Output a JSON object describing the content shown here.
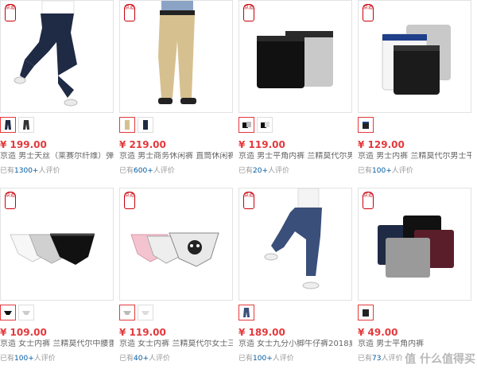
{
  "products": [
    {
      "seal": "京造",
      "price": "¥ 199.00",
      "title": "京造 男士天丝（莱赛尔纤维）弹力",
      "review_prefix": "已有",
      "review_count": "1300+",
      "review_suffix": "人评价",
      "thumbs": [
        "✕",
        "✕"
      ]
    },
    {
      "seal": "京造",
      "price": "¥ 219.00",
      "title": "京造 男士商务休闲裤 直筒休闲裤男",
      "review_prefix": "已有",
      "review_count": "600+",
      "review_suffix": "人评价",
      "thumbs": [
        "✕",
        "✕"
      ]
    },
    {
      "seal": "京造",
      "price": "¥ 119.00",
      "title": "京造 男士平角内裤 兰精莫代尔男士",
      "review_prefix": "已有",
      "review_count": "20+",
      "review_suffix": "人评价",
      "thumbs": [
        "✕",
        "✕"
      ]
    },
    {
      "seal": "京造",
      "price": "¥ 129.00",
      "title": "京造 男士内裤 兰精莫代尔男士平",
      "review_prefix": "已有",
      "review_count": "100+",
      "review_suffix": "人评价",
      "thumbs": [
        "✕"
      ]
    },
    {
      "seal": "京造",
      "price": "¥ 109.00",
      "title": "京造 女士内裤 兰精莫代尔中腰蕾丝",
      "review_prefix": "已有",
      "review_count": "100+",
      "review_suffix": "人评价",
      "thumbs": [
        "✕",
        "✕"
      ]
    },
    {
      "seal": "京造",
      "price": "¥ 119.00",
      "title": "京造 女士内裤 兰精莫代尔女士三角",
      "review_prefix": "已有",
      "review_count": "40+",
      "review_suffix": "人评价",
      "thumbs": [
        "✕",
        "✕"
      ]
    },
    {
      "seal": "京造",
      "price": "¥ 189.00",
      "title": "京造 女士九分小脚牛仔裤2018夏季",
      "review_prefix": "已有",
      "review_count": "100+",
      "review_suffix": "人评价",
      "thumbs": [
        "✕"
      ]
    },
    {
      "seal": "京造",
      "price": "¥ 49.00",
      "title": "京造 男士平角内裤",
      "review_prefix": "已有",
      "review_count": "73",
      "review_suffix": "人评价",
      "thumbs": [
        "✕"
      ]
    }
  ],
  "watermark": "值 什么值得买",
  "colors": {
    "price": "#e4393c",
    "link": "#005aa0",
    "seal": "#c9000b",
    "navy": "#1f2a44",
    "khaki": "#d7c08f",
    "black": "#111111",
    "grey": "#c9c9c9",
    "pink": "#f3c4cf"
  }
}
